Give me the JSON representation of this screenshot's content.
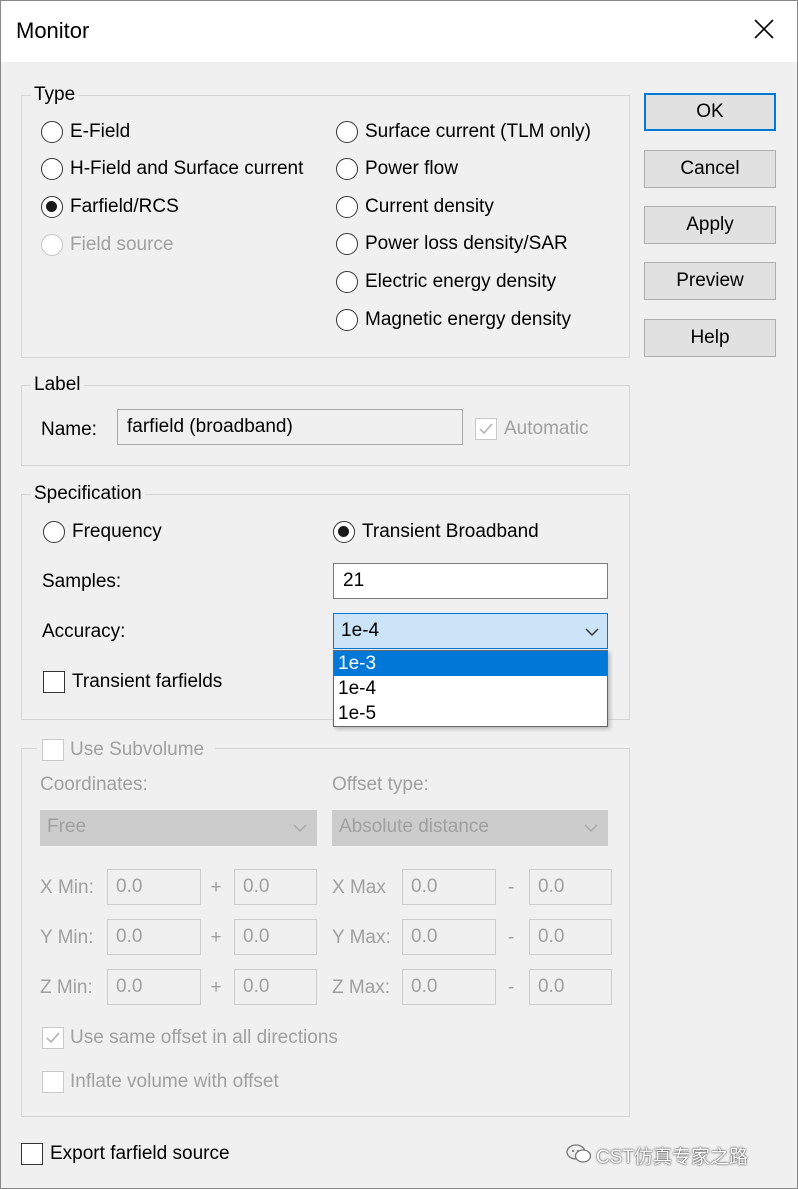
{
  "window": {
    "title": "Monitor"
  },
  "type_group": {
    "legend": "Type",
    "options": [
      {
        "label": "E-Field",
        "selected": false,
        "enabled": true
      },
      {
        "label": "H-Field and Surface current",
        "selected": false,
        "enabled": true
      },
      {
        "label": "Farfield/RCS",
        "selected": true,
        "enabled": true
      },
      {
        "label": "Field source",
        "selected": false,
        "enabled": false
      },
      {
        "label": "Surface current (TLM only)",
        "selected": false,
        "enabled": true
      },
      {
        "label": "Power flow",
        "selected": false,
        "enabled": true
      },
      {
        "label": "Current density",
        "selected": false,
        "enabled": true
      },
      {
        "label": "Power loss density/SAR",
        "selected": false,
        "enabled": true
      },
      {
        "label": "Electric energy density",
        "selected": false,
        "enabled": true
      },
      {
        "label": "Magnetic energy density",
        "selected": false,
        "enabled": true
      }
    ]
  },
  "buttons": {
    "ok": "OK",
    "cancel": "Cancel",
    "apply": "Apply",
    "preview": "Preview",
    "help": "Help"
  },
  "label_group": {
    "legend": "Label",
    "name_label": "Name:",
    "name_value": "farfield (broadband)",
    "automatic_label": "Automatic",
    "automatic_checked": true
  },
  "specification": {
    "legend": "Specification",
    "frequency_label": "Frequency",
    "transient_label": "Transient Broadband",
    "transient_selected": true,
    "samples_label": "Samples:",
    "samples_value": "21",
    "accuracy_label": "Accuracy:",
    "accuracy_value": "1e-4",
    "accuracy_options": [
      "1e-3",
      "1e-4",
      "1e-5"
    ],
    "accuracy_highlighted": "1e-3",
    "transient_farfields_label": "Transient farfields",
    "transient_farfields_checked": false
  },
  "subvolume": {
    "legend": "Use Subvolume",
    "checked": false,
    "coordinates_label": "Coordinates:",
    "coordinates_value": "Free",
    "offset_type_label": "Offset type:",
    "offset_type_value": "Absolute distance",
    "rows": [
      {
        "min_label": "X Min:",
        "min": "0.0",
        "min_off": "0.0",
        "max_label": "X Max",
        "max": "0.0",
        "max_off": "0.0"
      },
      {
        "min_label": "Y Min:",
        "min": "0.0",
        "min_off": "0.0",
        "max_label": "Y Max:",
        "max": "0.0",
        "max_off": "0.0"
      },
      {
        "min_label": "Z Min:",
        "min": "0.0",
        "min_off": "0.0",
        "max_label": "Z Max:",
        "max": "0.0",
        "max_off": "0.0"
      }
    ],
    "plus": "+",
    "minus": "-",
    "same_offset_label": "Use same offset in all directions",
    "same_offset_checked": true,
    "inflate_label": "Inflate volume with offset",
    "inflate_checked": false
  },
  "export": {
    "label": "Export farfield source",
    "checked": false
  },
  "watermark": "CST仿真专家之路",
  "icons": {
    "close": "close-icon",
    "chevron": "chevron-down-icon",
    "check": "checkmark-icon",
    "wechat": "wechat-logo-icon"
  },
  "colors": {
    "accent": "#0078d7",
    "disabled_text": "#a0a0a0",
    "dialog_bg": "#f0f0f0"
  }
}
